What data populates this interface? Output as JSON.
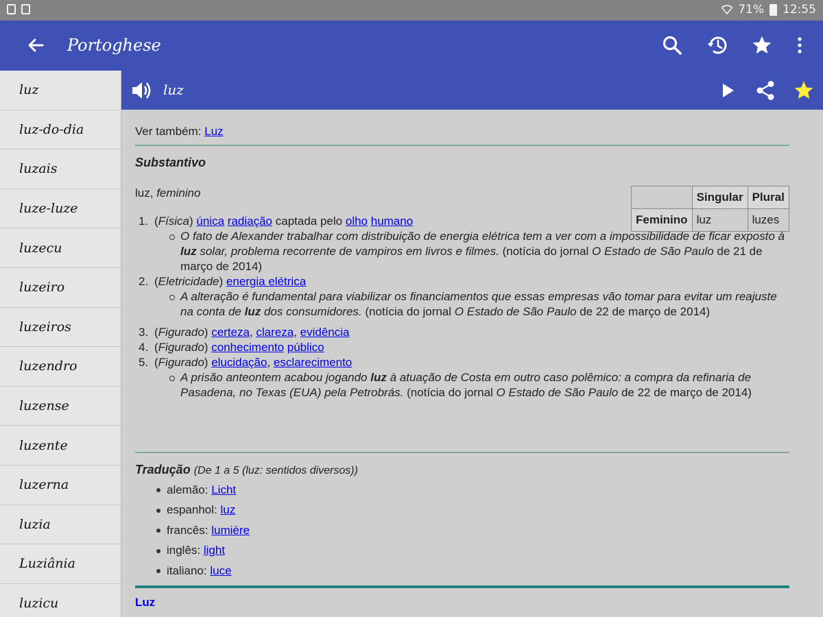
{
  "status_bar": {
    "battery_text": "71%",
    "time": "12:55"
  },
  "app_bar": {
    "title": "Portoghese"
  },
  "sidebar": {
    "items": [
      "luz",
      "luz-do-dia",
      "luzais",
      "luze-luze",
      "luzecu",
      "luzeiro",
      "luzeiros",
      "luzendro",
      "luzense",
      "luzente",
      "luzerna",
      "luzia",
      "Luziânia",
      "luzicu"
    ]
  },
  "word_bar": {
    "word": "luz"
  },
  "colors": {
    "primary": "#3f51b5",
    "accent_star": "#ffeb3b",
    "link": "#0000ee",
    "divider": "#1e8080"
  },
  "content": {
    "see_also_label": "Ver também:",
    "see_also_link": "Luz",
    "part_of_speech": "Substantivo",
    "lemma": "luz,",
    "gender": "feminino",
    "inflection": {
      "col_singular": "Singular",
      "col_plural": "Plural",
      "row_label": "Feminino",
      "singular": "luz",
      "plural": "luzes"
    },
    "senses": [
      {
        "num": "1.",
        "open": "(",
        "tag": "Física",
        "close": ")",
        "links": [
          "única",
          "radiação"
        ],
        "mid": "captada pelo",
        "links2": [
          "olho",
          "humano"
        ],
        "examples": [
          {
            "before": "O fato de Alexander trabalhar com distribuição de energia elétrica tem a ver com a impossibilidade de ficar exposto à",
            "bold": "luz",
            "after": "solar, problema recorrente de vampiros em livros e filmes.",
            "src_pre": "(notícia do jornal",
            "src_paper": "O Estado de São Paulo",
            "src_post": "de 21 de março de 2014)"
          }
        ]
      },
      {
        "num": "2.",
        "open": "(",
        "tag": "Eletricidade",
        "close": ")",
        "link_phrase": "energia elétrica",
        "examples": [
          {
            "before": "A alteração é fundamental para viabilizar os financiamentos que essas empresas vão tomar para evitar um reajuste na conta de",
            "bold": "luz",
            "after": "dos consumidores.",
            "src_pre": "(notícia do jornal",
            "src_paper": "O Estado de São Paulo",
            "src_post": "de 22 de março de 2014)"
          }
        ]
      },
      {
        "num": "3.",
        "open": "(",
        "tag": "Figurado",
        "close": ")",
        "links": [
          "certeza",
          "clareza",
          "evidência"
        ]
      },
      {
        "num": "4.",
        "open": "(",
        "tag": "Figurado",
        "close": ")",
        "links": [
          "conhecimento",
          "público"
        ]
      },
      {
        "num": "5.",
        "open": "(",
        "tag": "Figurado",
        "close": ")",
        "links": [
          "elucidação",
          "esclarecimento"
        ],
        "examples": [
          {
            "before": "A prisão anteontem acabou jogando",
            "bold": "luz",
            "after": "à atuação de Costa em outro caso polêmico: a compra da refinaria de Pasadena, no Texas (EUA) pela Petrobrás.",
            "src_pre": "(notícia do jornal",
            "src_paper": "O Estado de São Paulo",
            "src_post": "de 22 de março de 2014)"
          }
        ]
      }
    ],
    "translation": {
      "title": "Tradução",
      "qualifier": "(De 1 a 5 (luz: sentidos diversos))",
      "items": [
        {
          "lang": "alemão:",
          "word": "Licht"
        },
        {
          "lang": "espanhol:",
          "word": "luz"
        },
        {
          "lang": "francês:",
          "word": "lumière"
        },
        {
          "lang": "inglês:",
          "word": "light"
        },
        {
          "lang": "italiano:",
          "word": "luce"
        }
      ]
    },
    "bottom_heading": "Luz"
  }
}
